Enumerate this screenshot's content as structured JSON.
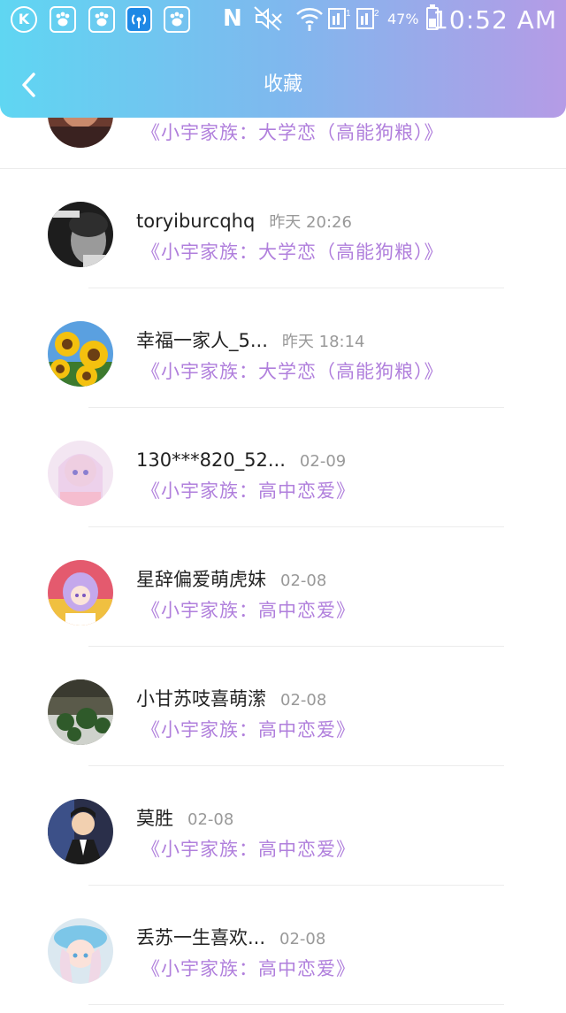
{
  "status_bar": {
    "left_icons": [
      "k-circle-icon",
      "baidu-paw-icon",
      "baidu-paw-icon",
      "wifi-hotspot-icon",
      "baidu-paw-icon"
    ],
    "right_icons": [
      "nfc-icon",
      "mute-icon",
      "wifi-icon",
      "sim1-icon",
      "sim2-icon"
    ],
    "battery": "47%",
    "battery_level": 0.47,
    "time": "10:52 AM"
  },
  "header": {
    "title": "收藏",
    "gradient": [
      "#5fd6f2",
      "#b59be6"
    ]
  },
  "colors": {
    "link": "#b07fdc",
    "name": "#222222",
    "time": "#999999"
  },
  "items": [
    {
      "name": "",
      "time": "",
      "favorite": "《小宇家族：大学恋（高能狗粮）》",
      "avatar": "partial-avatar"
    },
    {
      "name": "toryiburcqhq",
      "time": "昨天 20:26",
      "favorite": "《小宇家族：大学恋（高能狗粮）》",
      "avatar": "bw-portrait-avatar"
    },
    {
      "name": "幸福一家人_5...",
      "time": "昨天 18:14",
      "favorite": "《小宇家族：大学恋（高能狗粮）》",
      "avatar": "sunflower-avatar"
    },
    {
      "name": "130***820_52...",
      "time": "02-09",
      "favorite": "《小宇家族：高中恋爱》",
      "avatar": "anime-girl-pastel-avatar"
    },
    {
      "name": "星辞偏爱萌虎妹",
      "time": "02-08",
      "favorite": "《小宇家族：高中恋爱》",
      "avatar": "anime-girl-purple-avatar"
    },
    {
      "name": "小甘苏吱喜萌潆",
      "time": "02-08",
      "favorite": "《小宇家族：高中恋爱》",
      "avatar": "plants-photo-avatar"
    },
    {
      "name": "莫胜",
      "time": "02-08",
      "favorite": "《小宇家族：高中恋爱》",
      "avatar": "anime-man-avatar"
    },
    {
      "name": "丢苏一生喜欢...",
      "time": "02-08",
      "favorite": "《小宇家族：高中恋爱》",
      "avatar": "anime-girl-blue-avatar"
    }
  ]
}
